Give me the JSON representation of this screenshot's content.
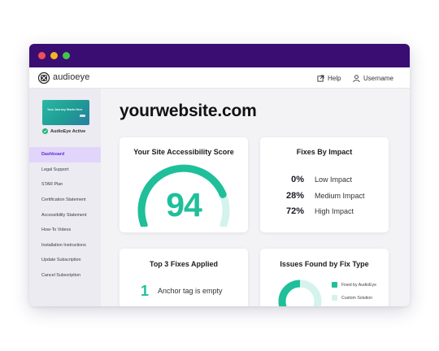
{
  "app": {
    "brand": "audioeye",
    "help_label": "Help",
    "username_label": "Username"
  },
  "sidebar": {
    "thumbnail_text": "Your Journey Starts Here.",
    "status": "AudioEye Active",
    "items": [
      {
        "label": "Dashboard",
        "active": true
      },
      {
        "label": "Legal Support"
      },
      {
        "label": "STAR Plan"
      },
      {
        "label": "Certification Statement"
      },
      {
        "label": "Accessibility Statement"
      },
      {
        "label": "How-To Videos"
      },
      {
        "label": "Installation Instructions"
      },
      {
        "label": "Update Subscription"
      },
      {
        "label": "Cancel Subscription"
      }
    ]
  },
  "main": {
    "site_title": "yourwebsite.com",
    "score_card": {
      "title": "Your Site Accessibility Score",
      "score": "94",
      "score_value": 94
    },
    "impact_card": {
      "title": "Fixes By Impact",
      "rows": [
        {
          "percent": "0%",
          "label": "Low Impact"
        },
        {
          "percent": "28%",
          "label": "Medium Impact"
        },
        {
          "percent": "72%",
          "label": "High Impact"
        }
      ]
    },
    "top_fixes_card": {
      "title": "Top 3 Fixes Applied",
      "items": [
        {
          "rank": "1",
          "label": "Anchor tag is empty"
        }
      ]
    },
    "issues_card": {
      "title": "Issues Found by Fix Type",
      "legend": [
        {
          "label": "Fixed by AudioEye",
          "color": "#1fbf9a"
        },
        {
          "label": "Custom Solution",
          "color": "#d3f3ec"
        }
      ]
    }
  },
  "colors": {
    "titlebar": "#3a0d73",
    "accent_teal": "#1fbf9a",
    "teal_light": "#d3f3ec",
    "nav_active_bg": "#e2d5fb",
    "nav_active_text": "#5e2bd3"
  }
}
